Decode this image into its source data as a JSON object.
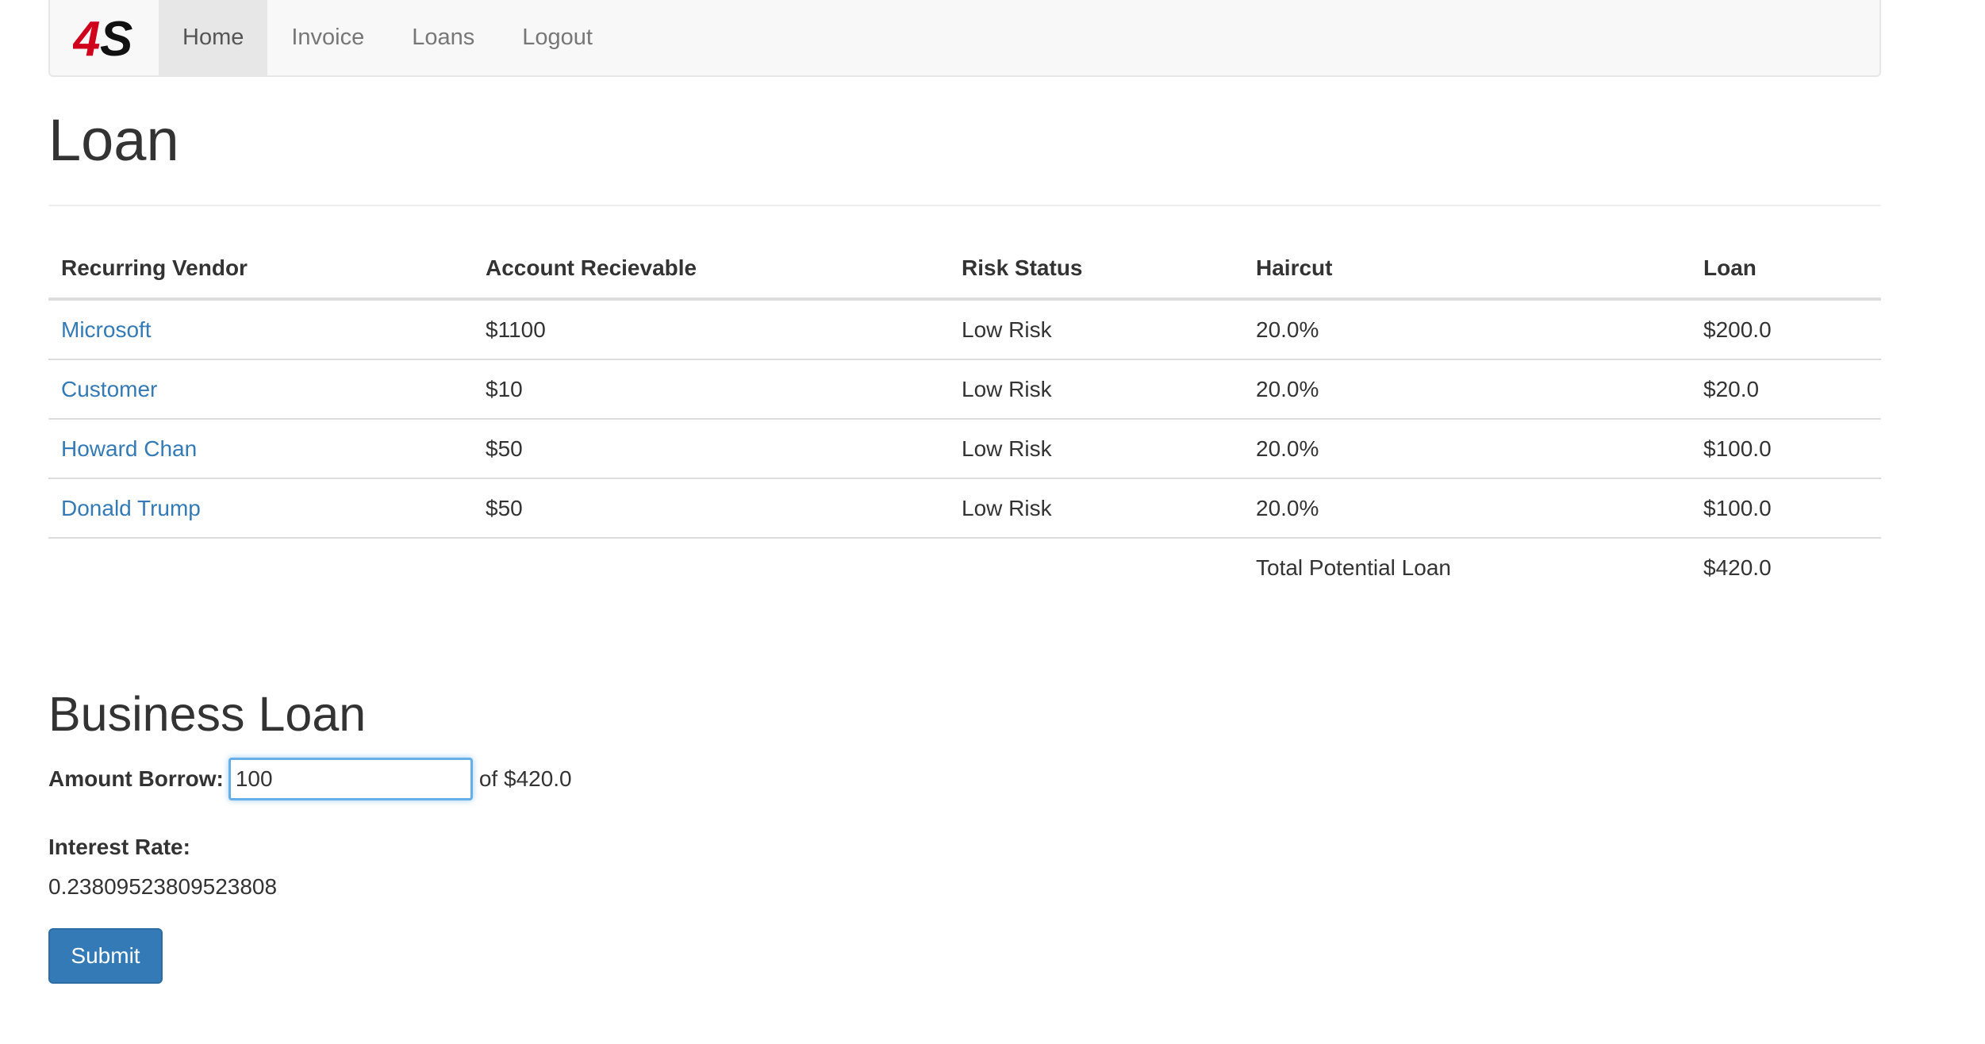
{
  "navbar": {
    "brand_logo": "4S",
    "items": [
      {
        "label": "Home",
        "active": true
      },
      {
        "label": "Invoice",
        "active": false
      },
      {
        "label": "Loans",
        "active": false
      },
      {
        "label": "Logout",
        "active": false
      }
    ]
  },
  "page_title": "Loan",
  "table": {
    "headers": [
      "Recurring Vendor",
      "Account Recievable",
      "Risk Status",
      "Haircut",
      "Loan"
    ],
    "rows": [
      {
        "vendor": "Microsoft",
        "receivable": "$1100",
        "risk": "Low Risk",
        "haircut": "20.0%",
        "loan": "$200.0"
      },
      {
        "vendor": "Customer",
        "receivable": "$10",
        "risk": "Low Risk",
        "haircut": "20.0%",
        "loan": "$20.0"
      },
      {
        "vendor": "Howard Chan",
        "receivable": "$50",
        "risk": "Low Risk",
        "haircut": "20.0%",
        "loan": "$100.0"
      },
      {
        "vendor": "Donald Trump",
        "receivable": "$50",
        "risk": "Low Risk",
        "haircut": "20.0%",
        "loan": "$100.0"
      }
    ],
    "total_label": "Total Potential Loan",
    "total_value": "$420.0"
  },
  "business_loan": {
    "title": "Business Loan",
    "amount_label": "Amount Borrow:",
    "amount_value": "100",
    "amount_suffix": "of $420.0",
    "interest_label": "Interest Rate:",
    "interest_value": "0.23809523809523808",
    "submit_label": "Submit"
  },
  "colors": {
    "link": "#337ab7",
    "button": "#337ab7",
    "logo_red": "#d0021b",
    "logo_black": "#111111"
  }
}
